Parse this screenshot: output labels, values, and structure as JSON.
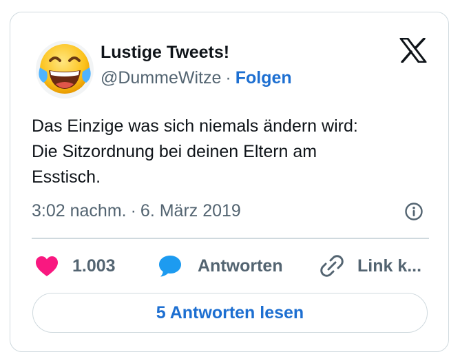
{
  "account": {
    "name": "Lustige Tweets!",
    "handle": "@DummeWitze",
    "separator": "·",
    "follow_label": "Folgen",
    "avatar": "face-with-tears-of-joy-emoji"
  },
  "platform_icon": "x-logo-icon",
  "tweet": {
    "text": "Das Einzige was sich niemals ändern wird:\nDie Sitzordnung bei deinen Eltern am\nEsstisch.",
    "time": "3:02 nachm.",
    "separator": "·",
    "date": "6. März 2019"
  },
  "actions": {
    "like_count": "1.003",
    "reply_label": "Antworten",
    "copy_link_label": "Link k..."
  },
  "read_replies_label": "5 Antworten lesen",
  "colors": {
    "accent": "#1d6fd1",
    "heart": "#f91880",
    "reply_bubble": "#1d9bf0",
    "muted_text": "#536471",
    "border": "#cfd9de"
  }
}
